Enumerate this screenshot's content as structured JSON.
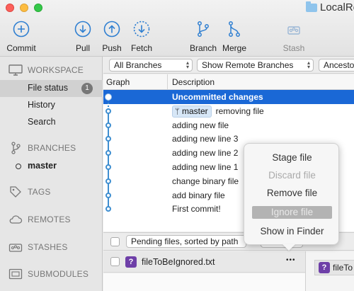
{
  "window": {
    "title": "LocalRe"
  },
  "toolbar": {
    "commit": "Commit",
    "pull": "Pull",
    "push": "Push",
    "fetch": "Fetch",
    "branch": "Branch",
    "merge": "Merge",
    "stash": "Stash"
  },
  "sidebar": {
    "workspace": "WORKSPACE",
    "file_status": "File status",
    "file_status_badge": "1",
    "history": "History",
    "search": "Search",
    "branches": "BRANCHES",
    "master": "master",
    "tags": "TAGS",
    "remotes": "REMOTES",
    "stashes": "STASHES",
    "submodules": "SUBMODULES"
  },
  "filters": {
    "branches": "All Branches",
    "remote": "Show Remote Branches",
    "ancestor": "Ancesto"
  },
  "columns": {
    "graph": "Graph",
    "description": "Description"
  },
  "commits": [
    {
      "desc": "Uncommitted changes"
    },
    {
      "tag": "master",
      "desc": "removing file"
    },
    {
      "desc": "adding new file"
    },
    {
      "desc": "adding new line 3"
    },
    {
      "desc": "adding new line 2"
    },
    {
      "desc": "adding new line 1"
    },
    {
      "desc": "change binary file"
    },
    {
      "desc": "add binary file"
    },
    {
      "desc": "First commit!"
    }
  ],
  "pending": {
    "sort_label": "Pending files, sorted by path"
  },
  "file": {
    "name": "fileToBeIgnored.txt",
    "icon": "?",
    "more": "•••"
  },
  "right_pane": {
    "file_label": "fileTo"
  },
  "context_menu": {
    "stage": "Stage file",
    "discard": "Discard file",
    "remove": "Remove file",
    "ignore": "Ignore file",
    "finder": "Show in Finder"
  },
  "colors": {
    "selection": "#1a68d6",
    "graph": "#3e8ed0",
    "unknown_file": "#6e3fa8"
  }
}
